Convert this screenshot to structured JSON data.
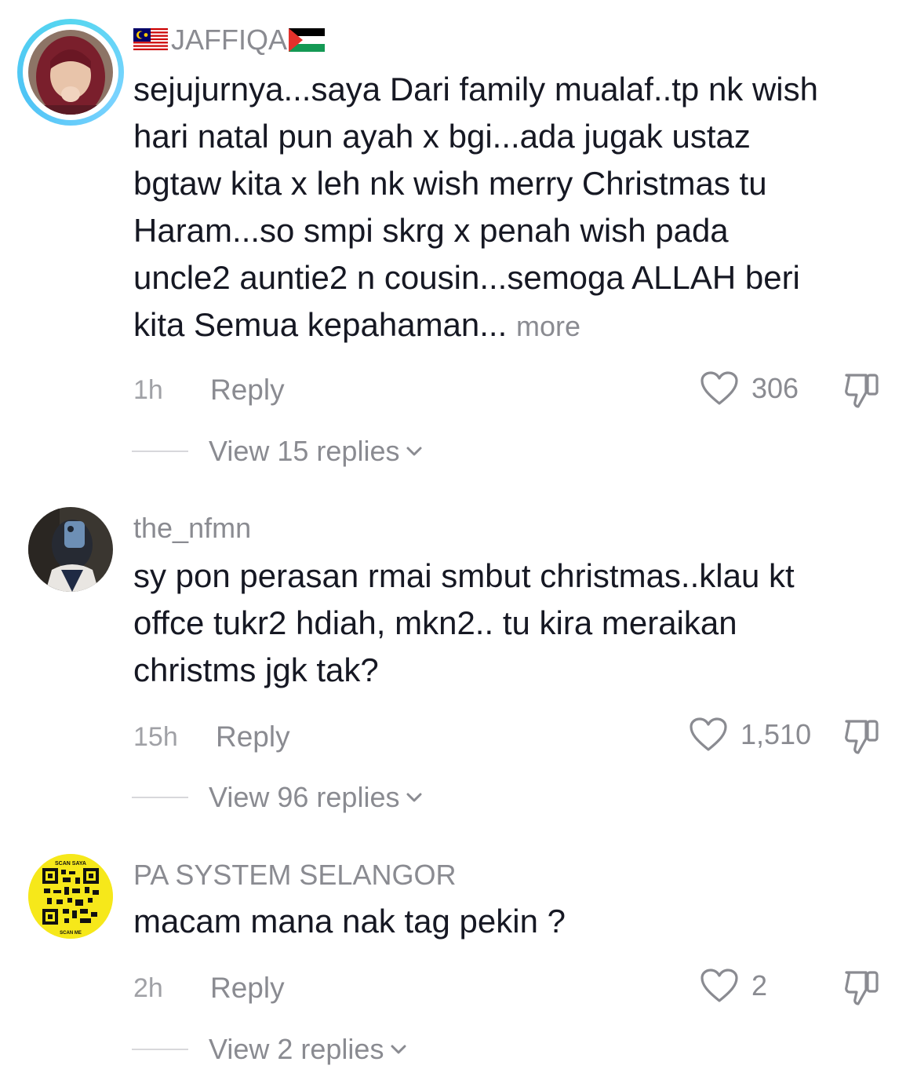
{
  "comments": [
    {
      "username": "JAFFIQA",
      "text": "sejujurnya...saya Dari family mualaf..tp nk wish\nhari natal pun ayah x bgi...ada jugak ustaz\nbgtaw kita x leh nk wish merry Christmas tu\nHaram...so smpi skrg x penah wish pada\nuncle2 auntie2 n cousin...semoga ALLAH beri\nkita Semua kepahaman...",
      "more_label": "more",
      "time": "1h",
      "reply_label": "Reply",
      "likes": "306",
      "view_replies": "View 15 replies",
      "flags": [
        "malaysia-flag-icon",
        "palestine-flag-icon"
      ]
    },
    {
      "username": "the_nfmn",
      "text": "sy pon perasan rmai smbut christmas..klau kt\noffce tukr2 hdiah, mkn2.. tu kira meraikan\nchristms jgk tak?",
      "time": "15h",
      "reply_label": "Reply",
      "likes": "1,510",
      "view_replies": "View 96 replies"
    },
    {
      "username": "PA SYSTEM SELANGOR",
      "text": "macam mana nak tag pekin ?",
      "time": "2h",
      "reply_label": "Reply",
      "likes": "2",
      "view_replies": "View 2 replies",
      "avatar_text_top": "SCAN SAYA",
      "avatar_text_bottom": "SCAN ME"
    }
  ],
  "colors": {
    "primary_text": "#161823",
    "secondary_text": "#8a8b91",
    "story_ring": "#56d6f0",
    "qr_yellow": "#f6e81a"
  }
}
